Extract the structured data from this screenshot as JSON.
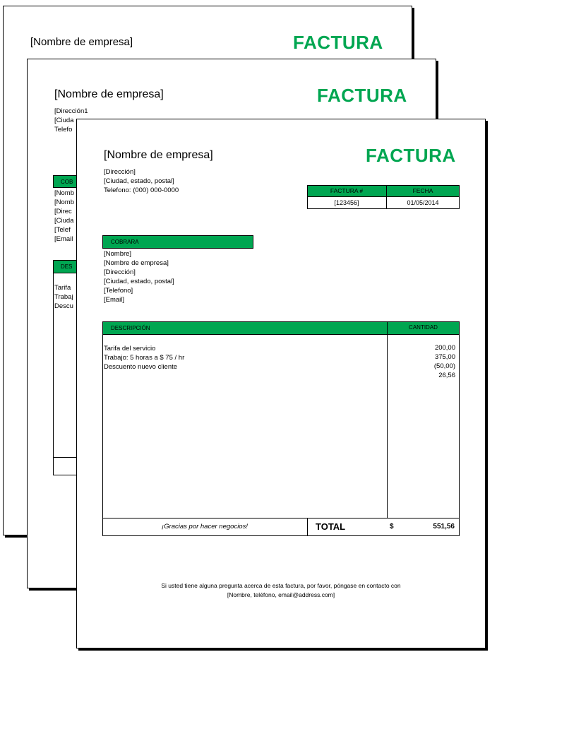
{
  "invoice": {
    "company_name": "[Nombre de empresa]",
    "title": "FACTURA",
    "address": "[Dirección]",
    "address_alt": "[Dirección1",
    "city": "[Ciudad, estado, postal]",
    "city_partial": "[Ciuda",
    "phone": "Telefono: (000) 000-0000",
    "phone_partial": "Telefo",
    "invoice_header": "FACTURA #",
    "date_header": "FECHA",
    "invoice_number": "[123456]",
    "invoice_date": "01/05/2014",
    "bill_to_header": "COBRARA",
    "bill_to_partial": "COB",
    "bill_to": {
      "name": "[Nombre]",
      "company": "[Nombre de empresa]",
      "address": "[Dirección]",
      "city": "[Ciudad, estado, postal]",
      "phone": "[Telefono]",
      "email": "[Email]"
    },
    "bill_to_partial_lines": [
      "[Nomb",
      "[Nomb",
      "[Direc",
      "[Ciuda",
      "[Telef",
      "[Email"
    ],
    "desc_header": "DESCRIPCIÓN",
    "desc_partial": "DES",
    "qty_header": "CANTIDAD",
    "items": [
      {
        "desc": "Tarifa del servicio",
        "amount": "200,00"
      },
      {
        "desc": "Trabajo: 5 horas a $ 75 / hr",
        "amount": "375,00"
      },
      {
        "desc": "Descuento nuevo cliente",
        "amount": "(50,00)"
      },
      {
        "desc": "",
        "amount": "26,56"
      }
    ],
    "items_partial": [
      "Tarifa",
      "Trabaj",
      "Descu"
    ],
    "thanks": "¡Gracias por hacer negocios!",
    "total_label": "TOTAL",
    "currency": "$",
    "total": "551,56",
    "footer_line1": "Si usted tiene alguna pregunta acerca de esta factura, por favor, póngase en contacto con",
    "footer_line2": "[Nombre, teléfono, email@address.com]"
  },
  "colors": {
    "accent": "#00a651"
  }
}
